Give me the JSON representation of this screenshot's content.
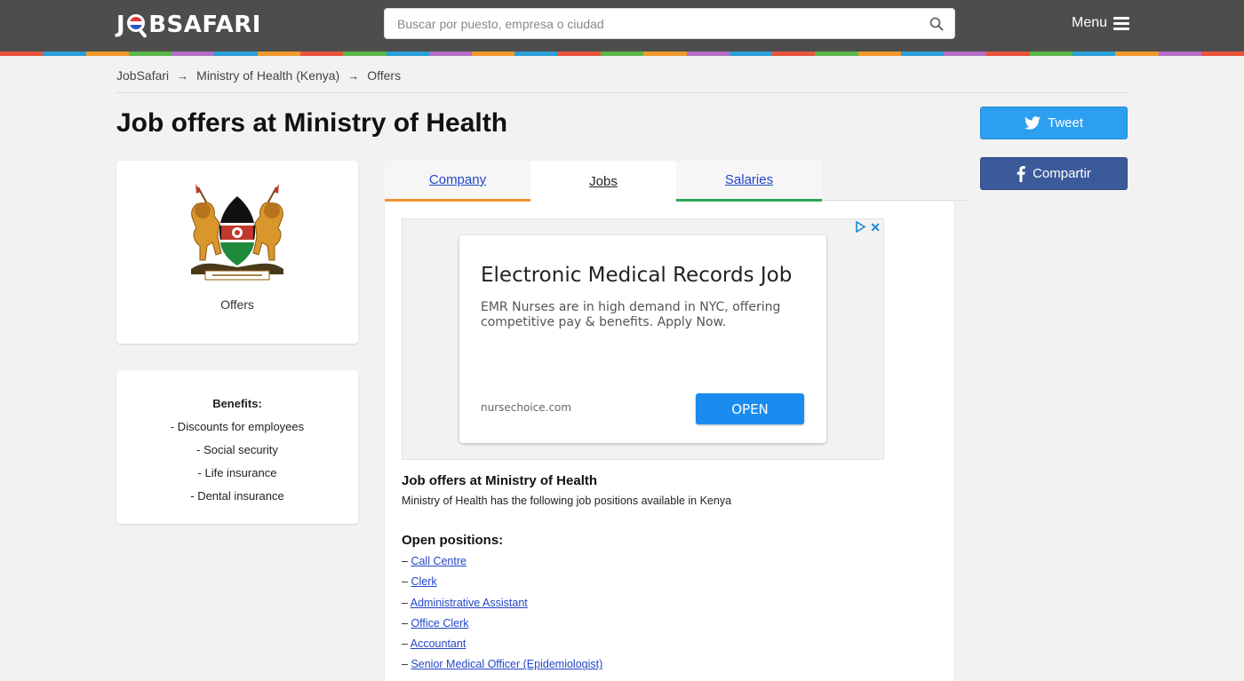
{
  "header": {
    "logo_left": "J",
    "logo_right": "BSAFARI",
    "search_placeholder": "Buscar por puesto, empresa o ciudad",
    "menu_label": "Menu",
    "stripe_colors": [
      "#e8543a",
      "#2a9fd6",
      "#ef9a2b",
      "#5ab84a",
      "#b46fc7",
      "#2a9fd6",
      "#ef9a2b",
      "#e8543a",
      "#5ab84a",
      "#2a9fd6",
      "#b46fc7",
      "#ef9a2b",
      "#2a9fd6",
      "#e8543a",
      "#5ab84a",
      "#ef9a2b",
      "#b46fc7",
      "#2a9fd6",
      "#e8543a",
      "#5ab84a",
      "#ef9a2b",
      "#2a9fd6",
      "#b46fc7",
      "#e8543a",
      "#5ab84a",
      "#2a9fd6",
      "#ef9a2b",
      "#b46fc7",
      "#e8543a"
    ]
  },
  "breadcrumb": {
    "items": [
      "JobSafari",
      "Ministry of Health (Kenya)",
      "Offers"
    ],
    "separator": "→"
  },
  "page_title": "Job offers at Ministry of Health",
  "social": {
    "tweet_label": "Tweet",
    "share_label": "Compartir"
  },
  "company_card": {
    "caption": "Offers"
  },
  "benefits": {
    "title": "Benefits:",
    "items": [
      "- Discounts for employees",
      "- Social security",
      "- Life insurance",
      "- Dental insurance"
    ]
  },
  "tabs": [
    {
      "label": "Company"
    },
    {
      "label": "Jobs"
    },
    {
      "label": "Salaries"
    }
  ],
  "ad": {
    "title": "Electronic Medical Records Job",
    "text": "EMR Nurses are in high demand in NYC, offering competitive pay & benefits. Apply Now.",
    "domain": "nursechoice.com",
    "button_label": "OPEN",
    "close_glyph": "✕"
  },
  "content": {
    "heading": "Job offers at Ministry of Health",
    "description": "Ministry of Health has the following job positions available in Kenya",
    "open_heading": "Open positions:",
    "bullet": "– ",
    "positions": [
      "Call Centre",
      "Clerk",
      "Administrative Assistant",
      "Office Clerk",
      "Accountant",
      "Senior Medical Officer (Epidemiologist)"
    ]
  },
  "colors": {
    "header_bg": "#4d4d4d",
    "link": "#2346c8",
    "tweet": "#2c9ff0",
    "facebook": "#3b5a9a",
    "tab_company_accent": "#f0922e",
    "tab_salaries_accent": "#2aa756",
    "ad_button": "#1a8cf0"
  }
}
